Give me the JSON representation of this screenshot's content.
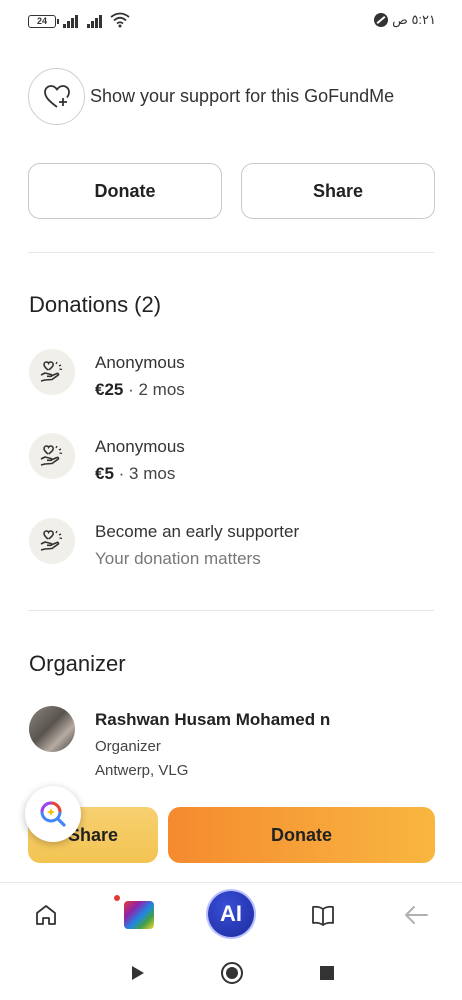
{
  "status_bar": {
    "battery": "24",
    "time": "٥:٢١ ص"
  },
  "support": {
    "icon": "heart-plus-icon",
    "text": "Show your support for this GoFundMe"
  },
  "actions": {
    "donate_label": "Donate",
    "share_label": "Share"
  },
  "donations": {
    "title": "Donations (2)",
    "items": [
      {
        "name": "Anonymous",
        "amount": "€25",
        "time": " · 2 mos"
      },
      {
        "name": "Anonymous",
        "amount": "€5",
        "time": " · 3 mos"
      }
    ],
    "cta": {
      "title": "Become an early supporter",
      "subtitle": "Your donation matters"
    }
  },
  "organizer": {
    "title": "Organizer",
    "name": "Rashwan Husam Mohamed n",
    "role": "Organizer",
    "location": "Antwerp, VLG"
  },
  "sticky": {
    "share_label": "Share",
    "donate_label": "Donate"
  },
  "browser_nav": {
    "ai_label": "AI"
  },
  "colors": {
    "accent_orange": "#f7a53a",
    "accent_yellow": "#f3c453",
    "ai_blue": "#1b2a9c"
  }
}
